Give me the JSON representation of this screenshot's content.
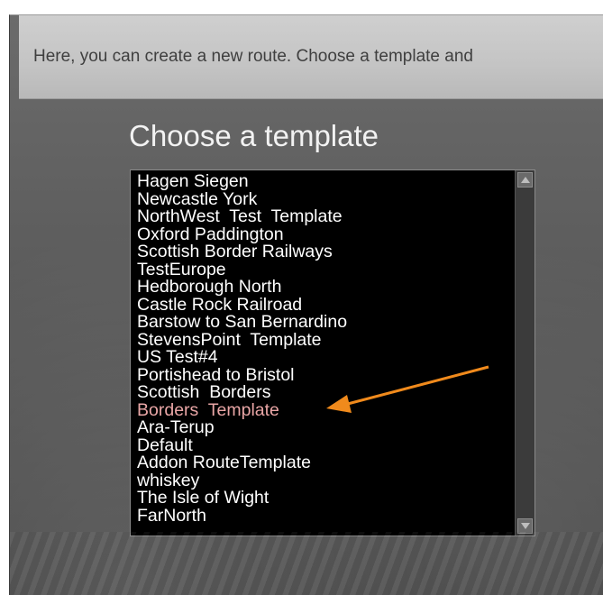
{
  "info": {
    "text": "Here, you can create a new route. Choose a template and"
  },
  "heading": "Choose a template",
  "template_list": {
    "items": [
      "Hagen Siegen",
      "Newcastle York",
      "NorthWest  Test  Template",
      "Oxford Paddington",
      "Scottish Border Railways",
      "TestEurope",
      "Hedborough North",
      "Castle Rock Railroad",
      "Barstow to San Bernardino",
      "StevensPoint  Template",
      "US Test#4",
      "Portishead to Bristol",
      "Scottish  Borders",
      "Borders  Template",
      "Ara-Terup",
      "Default",
      "Addon RouteTemplate",
      "whiskey",
      "The Isle of Wight",
      "FarNorth"
    ],
    "selected": "Borders  Template",
    "selected_color": "#e9a6a6"
  },
  "annotation": {
    "color": "#f08a1c",
    "icon": "arrow-annotation-icon"
  }
}
